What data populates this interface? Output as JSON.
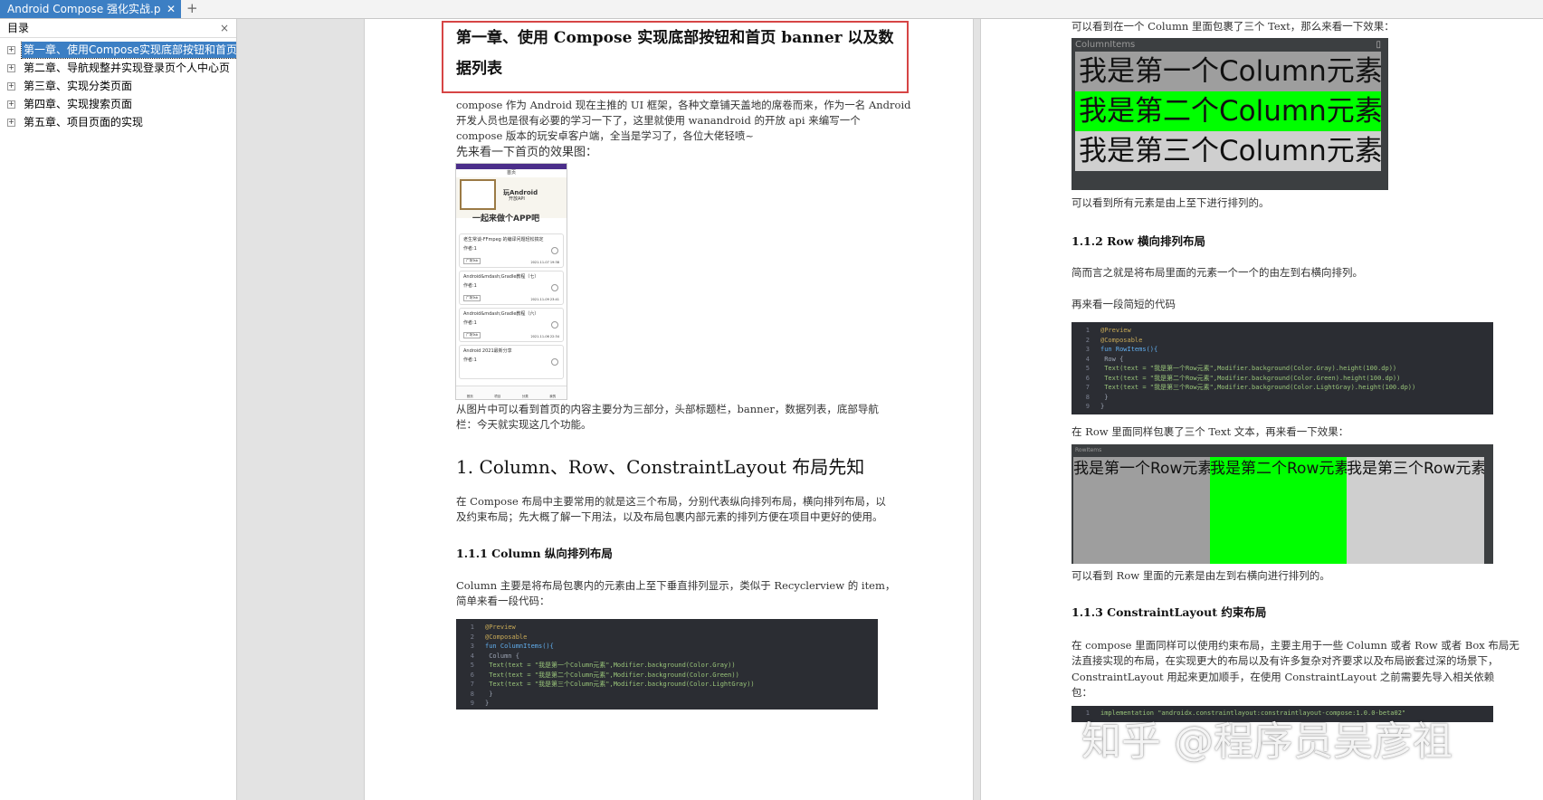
{
  "tab": {
    "title": "Android Compose 强化实战.p",
    "close": "✕",
    "new_tab": "+"
  },
  "sidebar": {
    "title": "目录",
    "close": "×",
    "items": [
      {
        "label": "第一章、使用Compose实现底部按钮和首页",
        "selected": true
      },
      {
        "label": "第二章、导航规整并实现登录页个人中心页"
      },
      {
        "label": "第三章、实现分类页面"
      },
      {
        "label": "第四章、实现搜索页面"
      },
      {
        "label": "第五章、项目页面的实现"
      }
    ]
  },
  "page1": {
    "chapter_title_l1": "第一章、使用 Compose 实现底部按钮和首页 banner 以及数",
    "chapter_title_l2": "据列表",
    "intro_l1": "compose 作为 Android 现在主推的 UI 框架，各种文章铺天盖地的席卷而来，作为一名 Android",
    "intro_l2": "开发人员也是很有必要的学习一下了，这里就使用 wanandroid 的开放 api 来编写一个",
    "intro_l3": "compose 版本的玩安卓客户端，全当是学习了，各位大佬轻喷~",
    "preview_caption": "先来看一下首页的效果图：",
    "phone": {
      "top_title": "首页",
      "banner_title": "玩Android",
      "banner_sub": "开放API",
      "banner_slogan": "一起来做个APP吧",
      "cards": [
        {
          "title": "老生常谈-FFmpeg 的编译问题轻松搞定",
          "author": "作者:1",
          "tag": "广场Tab",
          "date": "2021-11-07 19:38"
        },
        {
          "title": "Android&mdash;Gradle教程（七）",
          "author": "作者:1",
          "tag": "广场Tab",
          "date": "2021-11-09 23:41"
        },
        {
          "title": "Android&mdash;Gradle教程（六）",
          "author": "作者:1",
          "tag": "广场Tab",
          "date": "2021-11-06 22:34"
        },
        {
          "title": "Android 2021最新分享",
          "author": "作者:1",
          "tag": "广场Tab",
          "date": ""
        }
      ],
      "nav": [
        "首页",
        "项目",
        "分类",
        "我的"
      ]
    },
    "desc_l1": "从图片中可以看到首页的内容主要分为三部分，头部标题栏，banner，数据列表，底部导航",
    "desc_l2": "栏：今天就实现这几个功能。",
    "section1": "1. Column、Row、ConstraintLayout 布局先知",
    "section1_l1": "在 Compose 布局中主要常用的就是这三个布局，分别代表纵向排列布局，横向排列布局，以",
    "section1_l2": "及约束布局；先大概了解一下用法，以及布局包裹内部元素的排列方便在项目中更好的使用。",
    "sub111": "1.1.1 Column 纵向排列布局",
    "column_l1": "Column 主要是将布局包裹内的元素由上至下垂直排列显示，类似于 Recyclerview 的 item，",
    "column_l2": "简单来看一段代码：",
    "code1": [
      "@Preview",
      "@Composable",
      "fun ColumnItems(){",
      "    Column {",
      "        Text(text = \"我是第一个Column元素\",Modifier.background(Color.Gray))",
      "        Text(text = \"我是第二个Column元素\",Modifier.background(Color.Green))",
      "        Text(text = \"我是第三个Column元素\",Modifier.background(Color.LightGray))",
      "    }",
      "}"
    ]
  },
  "page2": {
    "col_intro": "可以看到在一个 Column 里面包裹了三个 Text，那么来看一下效果：",
    "col_preview_label": "ColumnItems",
    "col_rows": [
      {
        "text": "我是第一个Column元素",
        "color": "#9e9e9e"
      },
      {
        "text": "我是第二个Column元素",
        "color": "#00ff00"
      },
      {
        "text": "我是第三个Column元素",
        "color": "#cfcfcf"
      }
    ],
    "col_result": "可以看到所有元素是由上至下进行排列的。",
    "sub112": "1.1.2 Row 横向排列布局",
    "row_l1": "简而言之就是将布局里面的元素一个一个的由左到右横向排列。",
    "row_l2": "再来看一段简短的代码",
    "code2": [
      "@Preview",
      "@Composable",
      "fun RowItems(){",
      "    Row {",
      "        Text(text = \"我是第一个Row元素\",Modifier.background(Color.Gray).height(100.dp))",
      "        Text(text = \"我是第二个Row元素\",Modifier.background(Color.Green).height(100.dp))",
      "        Text(text = \"我是第三个Row元素\",Modifier.background(Color.LightGray).height(100.dp))",
      "    }",
      "}"
    ],
    "row_intro": "在 Row 里面同样包裹了三个 Text 文本，再来看一下效果：",
    "row_preview_label": "RowItems",
    "row_cells": [
      {
        "text": "我是第一个Row元素",
        "color": "#9e9e9e"
      },
      {
        "text": "我是第二个Row元素",
        "color": "#00ff00"
      },
      {
        "text": "我是第三个Row元素",
        "color": "#cfcfcf"
      }
    ],
    "row_result": "可以看到 Row 里面的元素是由左到右横向进行排列的。",
    "sub113": "1.1.3 ConstraintLayout 约束布局",
    "cl_l1": "在 compose 里面同样可以使用约束布局，主要主用于一些 Column 或者 Row 或者 Box 布局无",
    "cl_l2": "法直接实现的布局，在实现更大的布局以及有许多复杂对齐要求以及布局嵌套过深的场景下，",
    "cl_l3": "ConstraintLayout 用起来更加顺手，在使用 ConstraintLayout 之前需要先导入相关依赖",
    "cl_l4": "包：",
    "code3": "implementation \"androidx.constraintlayout:constraintlayout-compose:1.0.0-beta02\""
  },
  "watermark": "知乎 @程序员吴彦祖",
  "colors": {
    "tab_active": "#3c7fc4",
    "highlight_border": "#d64545",
    "code_bg": "#2b2d33"
  }
}
